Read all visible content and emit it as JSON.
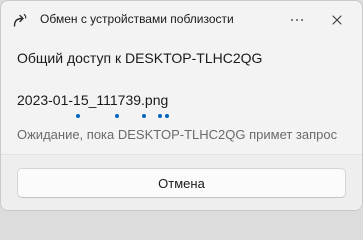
{
  "window": {
    "title": "Обмен с устройствами поблизости",
    "title_icon": "share-icon",
    "more_icon": "more-options-icon",
    "close_icon": "close-icon"
  },
  "heading": "Общий доступ к DESKTOP-TLHC2QG",
  "transfer": {
    "filename": "2023-01-15_111739.png",
    "progress_style": "indeterminate",
    "status": "Ожидание, пока DESKTOP-TLHC2QG примет запрос"
  },
  "footer": {
    "cancel_label": "Отмена"
  },
  "colors": {
    "accent": "#0067c0",
    "background": "#f3f3f3",
    "secondary_text": "#6a6a6a"
  }
}
